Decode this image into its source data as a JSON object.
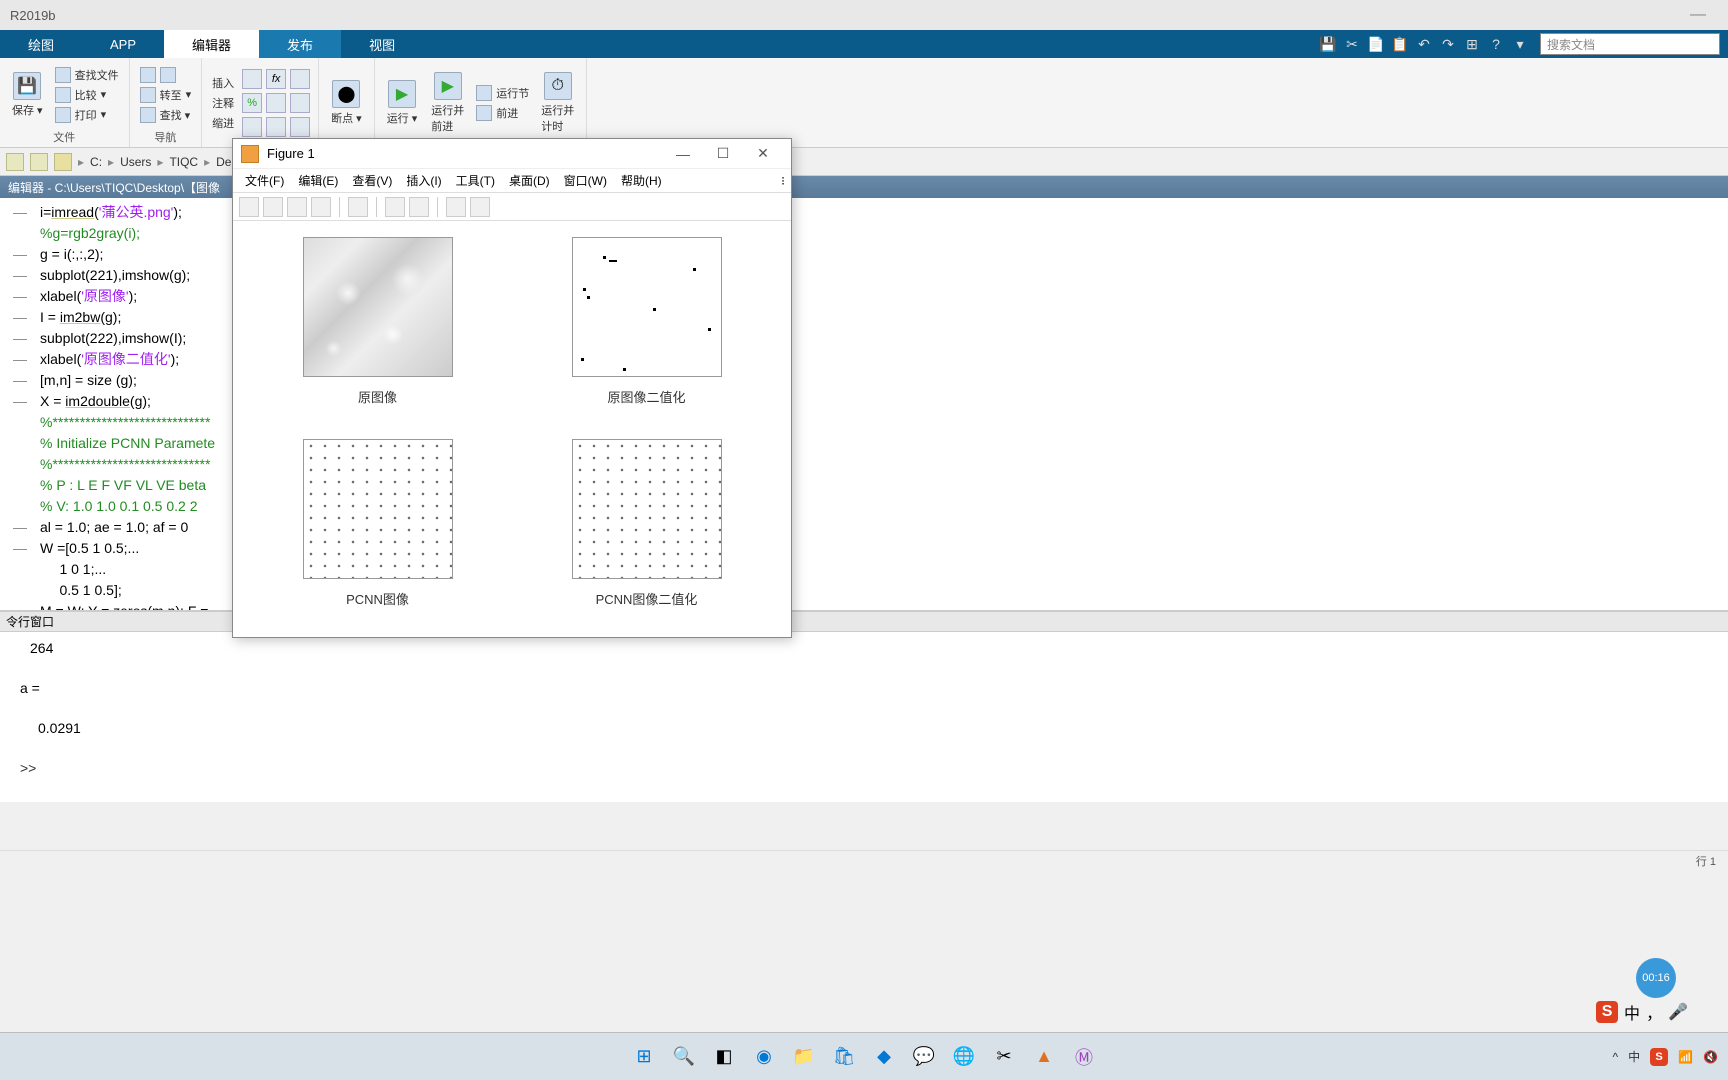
{
  "app_title": "R2019b",
  "tabs": {
    "plot": "绘图",
    "app": "APP",
    "editor": "编辑器",
    "publish": "发布",
    "view": "视图"
  },
  "search_placeholder": "搜索文档",
  "ribbon": {
    "save": "保存",
    "find_files": "查找文件",
    "compare": "比较",
    "print": "打印",
    "file_group": "文件",
    "goto": "转至",
    "nav": "导航",
    "insert": "插入",
    "comment": "注释",
    "indent": "缩进",
    "breakpoints": "断点",
    "run": "运行",
    "run_advance": "运行并\n前进",
    "run_section": "运行节",
    "advance": "前进",
    "run_time": "运行并\n计时"
  },
  "path": [
    "C:",
    "Users",
    "TIQC",
    "Desktop"
  ],
  "editor_title": "编辑器 - C:\\Users\\TIQC\\Desktop\\【图像",
  "code_lines": [
    {
      "g": "—",
      "pre": "i=",
      "fn": "imread",
      "mid": "(",
      "str": "'蒲公英.png'",
      "post": ");"
    },
    {
      "g": "",
      "cmt": "%g=rgb2gray(i);"
    },
    {
      "g": "—",
      "txt": "g = i(:,:,2);"
    },
    {
      "g": "—",
      "txt": "subplot(221),imshow(g);"
    },
    {
      "g": "—",
      "pre": "xlabel(",
      "str": "'原图像'",
      "post": ");"
    },
    {
      "g": "—",
      "pre": "I = ",
      "fn": "im2bw",
      "post": "(g);"
    },
    {
      "g": "—",
      "txt": "subplot(222),imshow(I);"
    },
    {
      "g": "—",
      "pre": "xlabel(",
      "str": "'原图像二值化'",
      "post": ");"
    },
    {
      "g": "—",
      "txt": "[m,n] = size (g);"
    },
    {
      "g": "—",
      "pre": "X = ",
      "fn": "im2double",
      "post": "(g);"
    },
    {
      "g": "",
      "cmt": "%*****************************"
    },
    {
      "g": "",
      "cmt": "% Initialize PCNN Paramete"
    },
    {
      "g": "",
      "cmt": "%*****************************"
    },
    {
      "g": "",
      "cmt": "% P : L E F VF VL VE beta "
    },
    {
      "g": "",
      "cmt": "% V: 1.0 1.0 0.1 0.5 0.2 2"
    },
    {
      "g": "—",
      "txt": "al = 1.0; ae = 1.0; af = 0"
    },
    {
      "g": "—",
      "txt": "W =[0.5 1 0.5;..."
    },
    {
      "g": "",
      "txt": "     1 0 1;..."
    },
    {
      "g": "",
      "txt": "     0.5 1 0.5];"
    },
    {
      "g": "",
      "txt": "M = W; Y = zeros(m,n); F ="
    }
  ],
  "cmd_title": "令行窗口",
  "cmd_output": {
    "first": "264",
    "var": "a =",
    "val": "0.0291",
    "prompt": ">>"
  },
  "statusbar": "行 1",
  "figure": {
    "title": "Figure 1",
    "menus": [
      "文件(F)",
      "编辑(E)",
      "查看(V)",
      "插入(I)",
      "工具(T)",
      "桌面(D)",
      "窗口(W)",
      "帮助(H)"
    ],
    "labels": [
      "原图像",
      "原图像二值化",
      "PCNN图像",
      "PCNN图像二值化"
    ]
  },
  "ime": {
    "s": "S",
    "zh": "中",
    "comma": "，",
    "mic": "🎤"
  },
  "timer": "00:16",
  "tray": {
    "up": "^",
    "zh": "中",
    "wifi": "📶",
    "vol": "🔇"
  }
}
